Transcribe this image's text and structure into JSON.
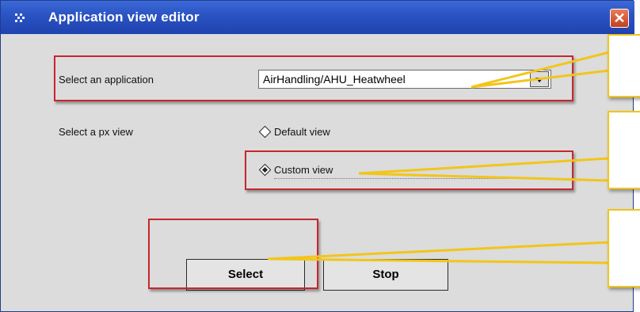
{
  "window": {
    "title": "Application view editor",
    "close_glyph": "✕"
  },
  "app_select": {
    "label": "Select an application",
    "value": "AirHandling/AHU_Heatwheel"
  },
  "px_view": {
    "label": "Select a px view",
    "options": [
      {
        "label": "Default view",
        "selected": false
      },
      {
        "label": "Custom view",
        "selected": true
      }
    ]
  },
  "buttons": {
    "select_label": "Select",
    "stop_label": "Stop"
  },
  "colors": {
    "highlight_box": "#c7262e",
    "callout": "#f2c51a"
  }
}
